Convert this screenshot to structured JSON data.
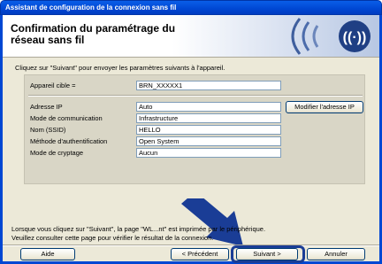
{
  "window": {
    "title": "Assistant de configuration de la connexion sans fil"
  },
  "header": {
    "title_line1": "Confirmation du paramétrage du",
    "title_line2": "réseau sans fil"
  },
  "intro": "Cliquez sur \"Suivant\" pour envoyer les paramètres suivants à l'appareil.",
  "fields": [
    {
      "label": "Appareil cible =",
      "value": "BRN_XXXXX1"
    },
    {
      "label": "Adresse IP",
      "value": "Auto"
    },
    {
      "label": "Mode de communication",
      "value": "Infrastructure"
    },
    {
      "label": "Nom (SSID)",
      "value": "HELLO"
    },
    {
      "label": "Méthode d'authentification",
      "value": "Open System"
    },
    {
      "label": "Mode de cryptage",
      "value": "Aucun"
    }
  ],
  "modify_ip_button": "Modifier l'adresse IP",
  "bottom_text_line1": "Lorsque vous cliquez sur \"Suivant\", la page \"WL...nt\" est imprimée par le périphérique.",
  "bottom_text_line2": "Veuillez consulter cette page pour vérifier le résultat de la connexion.",
  "buttons": {
    "help": "Aide",
    "back": "< Précédent",
    "next": "Suivant >",
    "cancel": "Annuler"
  },
  "colors": {
    "titlebar": "#0047d3",
    "highlight": "#1a3d96",
    "dialog_bg": "#ece9d8"
  }
}
